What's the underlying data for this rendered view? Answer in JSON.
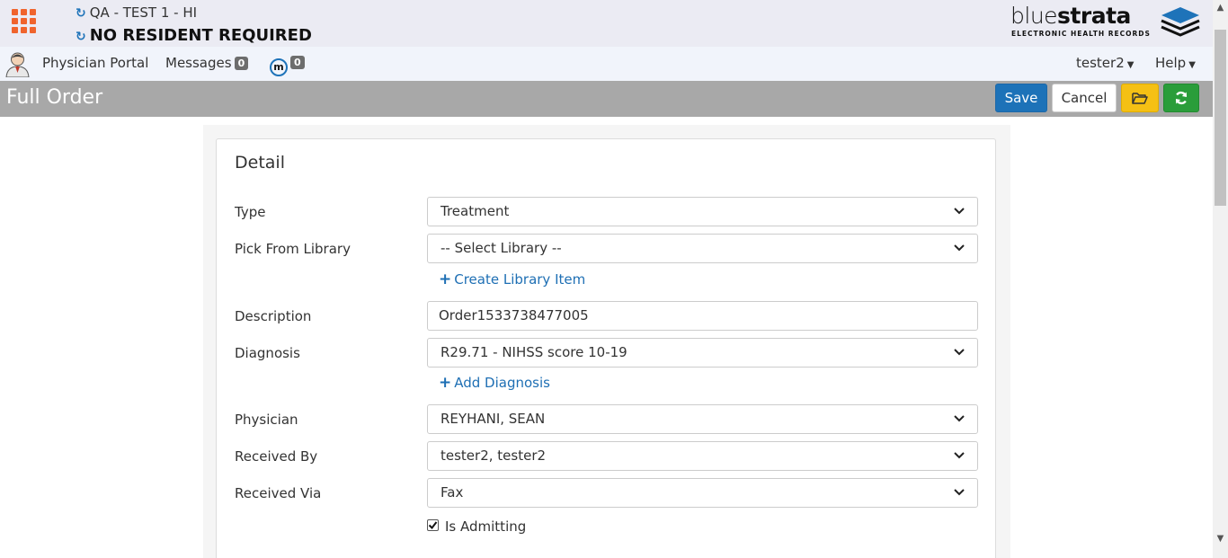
{
  "header": {
    "facility": "QA - TEST 1 - HI",
    "resident": "NO RESIDENT REQUIRED",
    "logo": {
      "blue": "blue",
      "strata": "strata",
      "tagline": "ELECTRONIC HEALTH RECORDS"
    }
  },
  "nav": {
    "physician_portal": "Physician Portal",
    "messages_label": "Messages",
    "messages_count": "0",
    "m_icon_letter": "m",
    "m_count": "0",
    "user": "tester2",
    "help": "Help"
  },
  "titlebar": {
    "title": "Full Order",
    "save": "Save",
    "cancel": "Cancel"
  },
  "form": {
    "section_title": "Detail",
    "type_label": "Type",
    "type_value": "Treatment",
    "library_label": "Pick From Library",
    "library_value": "-- Select Library --",
    "create_library_link": "Create Library Item",
    "description_label": "Description",
    "description_value": "Order1533738477005",
    "diagnosis_label": "Diagnosis",
    "diagnosis_value": "R29.71 - NIHSS score 10-19",
    "add_diagnosis_link": "Add Diagnosis",
    "physician_label": "Physician",
    "physician_value": "REYHANI, SEAN",
    "received_by_label": "Received By",
    "received_by_value": "tester2, tester2",
    "received_via_label": "Received Via",
    "received_via_value": "Fax",
    "is_admitting_label": "Is Admitting",
    "is_admitting_checked": true
  },
  "colors": {
    "accent_blue": "#1d72b8",
    "warning_yellow": "#f5c014",
    "success_green": "#2a9d3a",
    "apps_orange": "#f0642d",
    "titlebar_gray": "#a8a8a8"
  },
  "icons": [
    "apps-grid-icon",
    "refresh-icon",
    "user-avatar-icon",
    "m-icon",
    "folder-icon",
    "chevron-down-icon",
    "plus-icon",
    "checkbox-icon"
  ]
}
